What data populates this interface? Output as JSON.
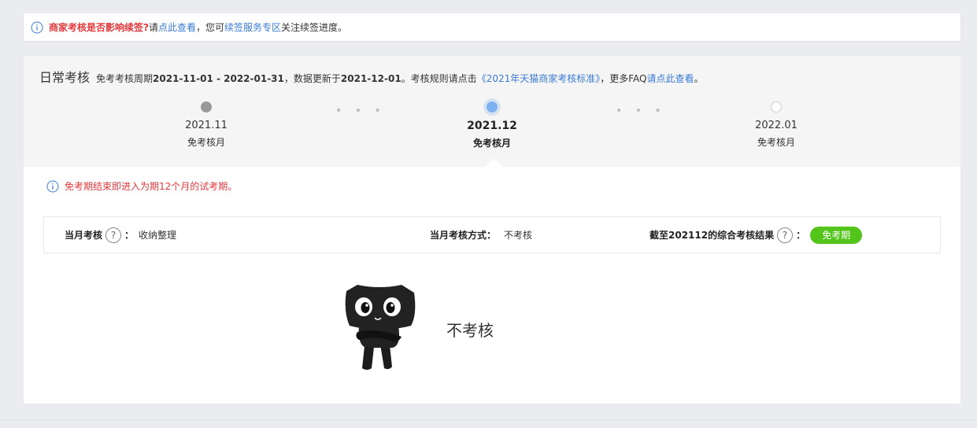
{
  "notice": {
    "question": "商家考核是否影响续签?",
    "text1": " 请",
    "link1": "点此查看",
    "text2": "，您可",
    "link2": "续签服务专区",
    "text3": "关注续签进度。"
  },
  "header": {
    "title": "日常考核",
    "desc_prefix": "免考考核周期",
    "period": "2021-11-01 - 2022-01-31",
    "desc_mid": "，数据更新于",
    "updated": "2021-12-01",
    "desc_rule": "。考核规则请点击",
    "rule_link": "《2021年天猫商家考核标准》",
    "desc_faq": "，更多FAQ",
    "faq_link": "请点此查看",
    "desc_end": "。"
  },
  "timeline": {
    "steps": [
      {
        "month": "2021.11",
        "label": "免考核月",
        "state": "past"
      },
      {
        "month": "2021.12",
        "label": "免考核月",
        "state": "current"
      },
      {
        "month": "2022.01",
        "label": "免考核月",
        "state": "future"
      }
    ],
    "ellipsis": "• • •"
  },
  "alert": {
    "text": "免考期结束即进入为期12个月的试考期。"
  },
  "info": {
    "monthly_label": "当月考核",
    "help": "?",
    "colon": "：",
    "monthly_value": "收纳整理",
    "method_label": "当月考核方式：",
    "method_value": "不考核",
    "result_label": "截至202112的综合考核结果",
    "result_badge": "免考期"
  },
  "empty": {
    "text": "不考核"
  },
  "colors": {
    "warn": "#e4393c",
    "link": "#3a7bd5",
    "badge": "#52c41a",
    "current_dot": "#7fb1ee"
  }
}
